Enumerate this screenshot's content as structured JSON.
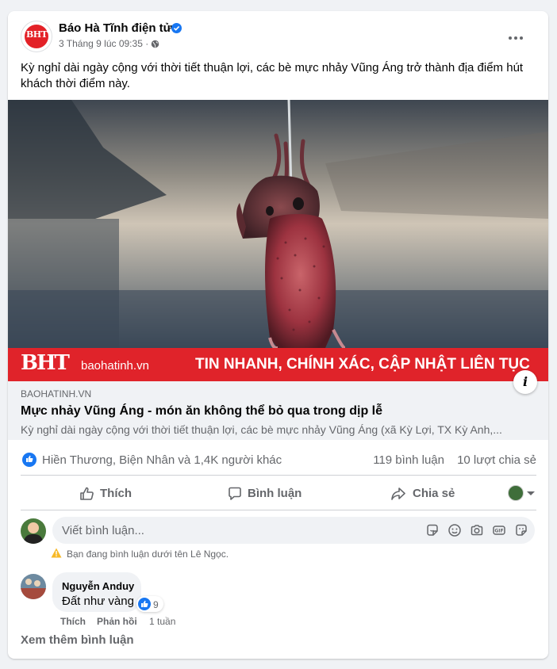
{
  "post": {
    "page_name": "Báo Hà Tĩnh điện tử",
    "page_avatar_text": "BHT",
    "timestamp": "3 Tháng 9 lúc 09:35 ·",
    "text": "Kỳ nghỉ dài ngày cộng với thời tiết thuận lợi, các bè mực nhảy Vũng Áng trở thành địa điểm hút khách thời điểm này."
  },
  "media": {
    "banner_logo": "BHT",
    "banner_site": "baohatinh.vn",
    "banner_slogan": "TIN NHANH, CHÍNH XÁC, CẬP NHẬT LIÊN TỤC"
  },
  "link_preview": {
    "domain": "BAOHATINH.VN",
    "title": "Mực nhảy Vũng Áng - món ăn không thể bỏ qua trong dịp lễ",
    "description": "Kỳ nghỉ dài ngày cộng với thời tiết thuận lợi, các bè mực nhảy Vũng Áng (xã Kỳ Lợi, TX Kỳ Anh,..."
  },
  "stats": {
    "reactors": "Hiền Thương, Biện Nhân và 1,4K người khác",
    "comments": "119 bình luận",
    "shares": "10 lượt chia sẻ"
  },
  "actions": {
    "like": "Thích",
    "comment": "Bình luận",
    "share": "Chia sẻ"
  },
  "composer": {
    "placeholder": "Viết bình luận...",
    "identity_notice": "Bạn đang bình luận dưới tên Lê Ngọc."
  },
  "comment": {
    "author": "Nguyễn Anduy",
    "text": "Đất như vàng",
    "reaction_count": "9",
    "like": "Thích",
    "reply": "Phản hồi",
    "time": "1 tuần"
  },
  "more_comments": "Xem thêm bình luận",
  "colors": {
    "brand_blue": "#1877f2",
    "banner_red": "#e0232a",
    "muted_text": "#65676b"
  },
  "icons": [
    "verified-icon",
    "globe-icon",
    "more-icon",
    "info-icon",
    "like-reaction-icon",
    "thumbs-up-icon",
    "comment-icon",
    "share-icon",
    "sticker-icon",
    "emoji-icon",
    "camera-icon",
    "gif-icon",
    "avatar-sticker-icon",
    "warning-icon"
  ]
}
